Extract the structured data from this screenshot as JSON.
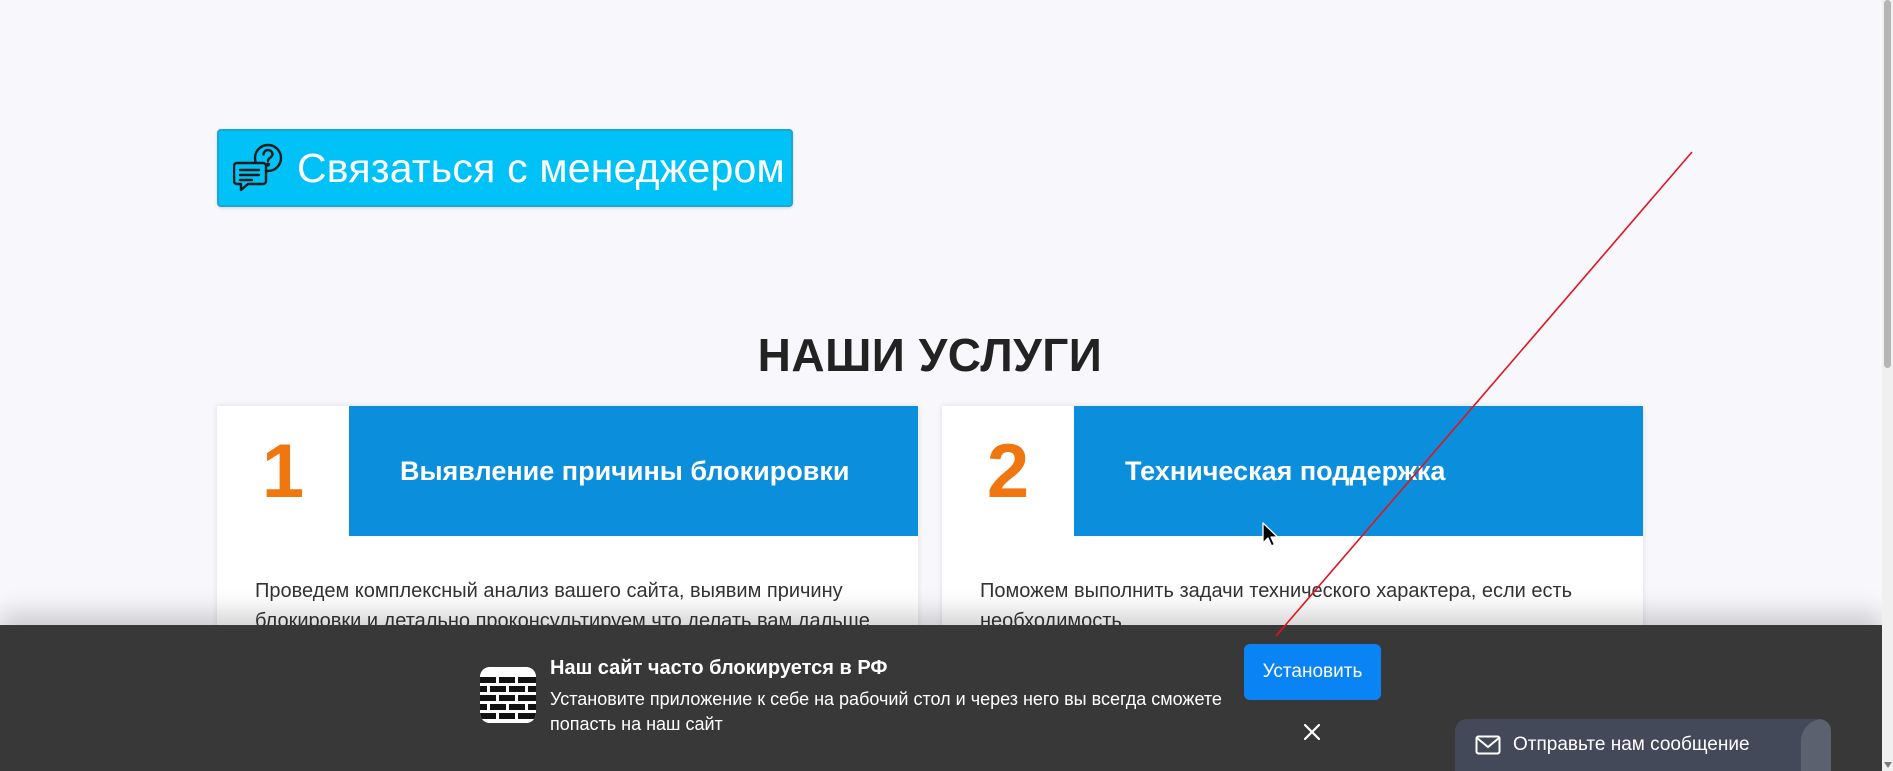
{
  "contact_button": {
    "label": "Связаться с менеджером",
    "icon": "chat-question-icon"
  },
  "services": {
    "title": "НАШИ УСЛУГИ",
    "cards": [
      {
        "number": "1",
        "title": "Выявление причины блокировки",
        "description": "Проведем комплексный анализ вашего сайта, выявим причину блокировки и детально проконсультируем что делать вам дальше"
      },
      {
        "number": "2",
        "title": "Техническая поддержка",
        "description": "Поможем выполнить задачи технического характера, если есть необходимость"
      }
    ]
  },
  "install_banner": {
    "title": "Наш сайт часто блокируется в РФ",
    "text": "Установите приложение к себе на рабочий стол и через него вы всегда сможете попасть на наш сайт",
    "install_label": "Установить",
    "app_icon": "brick-wall-icon",
    "close_icon": "close-icon"
  },
  "message_widget": {
    "label": "Отправьте нам сообщение",
    "icon": "mail-icon"
  },
  "colors": {
    "accent_cyan": "#00c2f7",
    "card_header_blue": "#0b8fdc",
    "number_orange": "#f0760f",
    "banner_dark": "#383838",
    "install_blue": "#0a84f5",
    "widget_dark": "#44495a",
    "annotation_red": "#e0141e"
  }
}
